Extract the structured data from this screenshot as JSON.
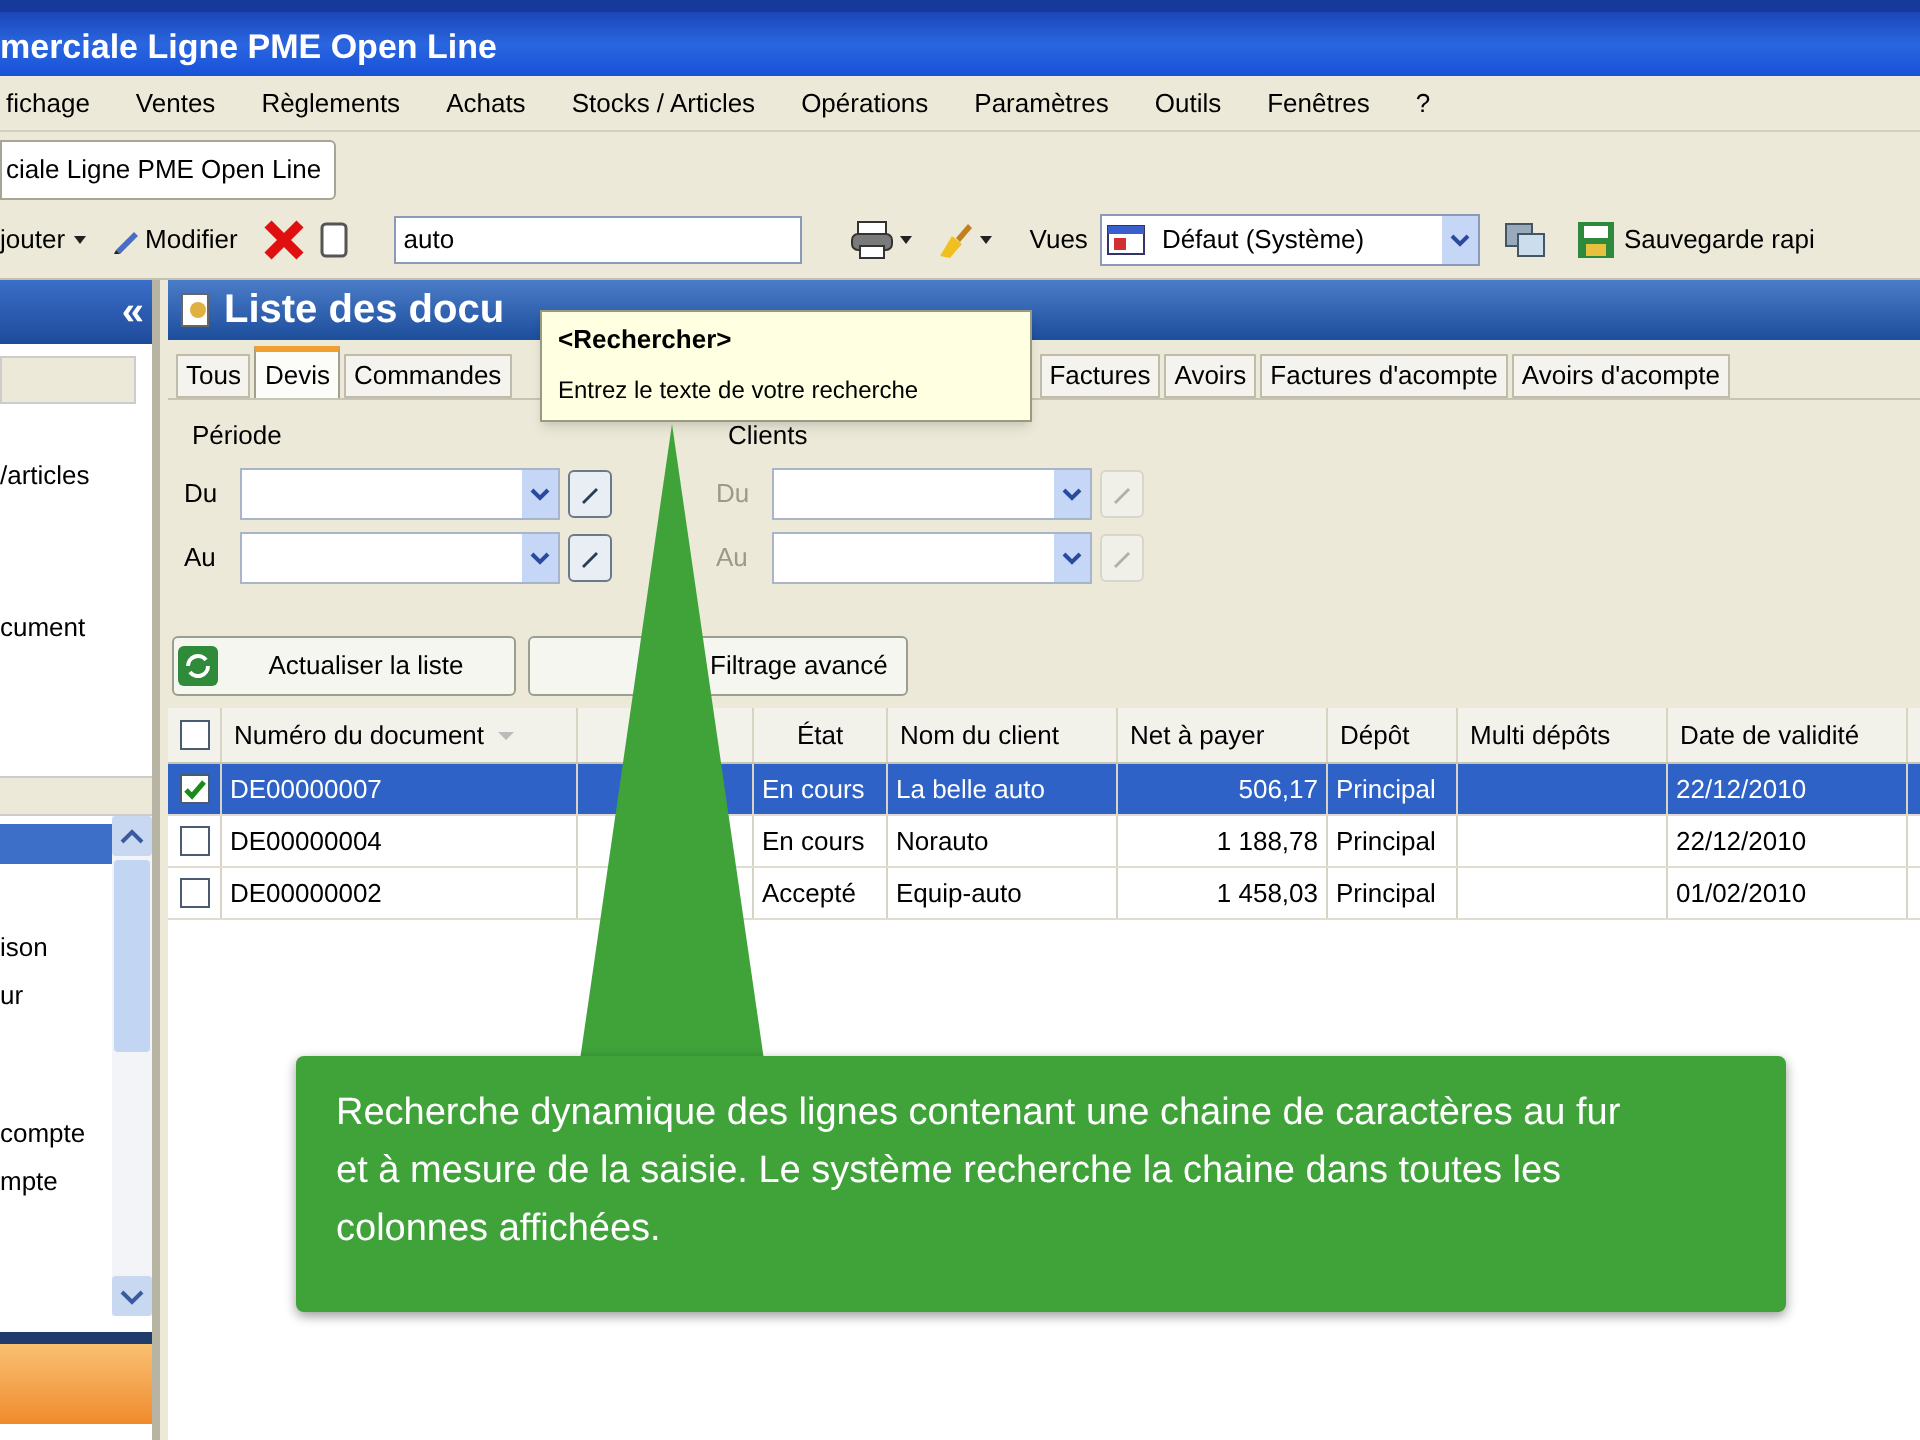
{
  "window": {
    "title": "merciale Ligne PME Open Line"
  },
  "menu": [
    "fichage",
    "Ventes",
    "Règlements",
    "Achats",
    "Stocks / Articles",
    "Opérations",
    "Paramètres",
    "Outils",
    "Fenêtres",
    "?"
  ],
  "document_tab": "ciale Ligne PME Open Line",
  "toolbar": {
    "add_label": "jouter",
    "edit_label": "Modifier",
    "search": {
      "value": "auto"
    },
    "views_label": "Vues",
    "view": "Défaut (Système)",
    "quick_save": "Sauvegarde rapi"
  },
  "sidebar": {
    "collapse": "«",
    "top_items": [
      "/articles",
      "cument"
    ],
    "bottom_items": [
      {
        "selected": true
      },
      {
        "label": "ison",
        "selected": false
      },
      {
        "label": "ur",
        "selected": false
      },
      {
        "label": "compte",
        "selected": false
      },
      {
        "label": "mpte",
        "selected": false
      }
    ]
  },
  "panel": {
    "title": "Liste des docu",
    "tabs": [
      {
        "label": "Tous",
        "selected": false
      },
      {
        "label": "Devis",
        "selected": true
      },
      {
        "label": "Commandes",
        "selected": false
      },
      {
        "label": "Factures",
        "selected": false
      },
      {
        "label": "Avoirs",
        "selected": false
      },
      {
        "label": "Factures d'acompte",
        "selected": false
      },
      {
        "label": "Avoirs d'acompte",
        "selected": false
      }
    ],
    "tooltip": {
      "title": "<Rechercher>",
      "text": "Entrez le texte de votre recherche"
    },
    "period": {
      "legend": "Période",
      "from_label": "Du",
      "to_label": "Au",
      "disabled": false
    },
    "clients": {
      "legend": "Clients",
      "from_label": "Du",
      "to_label": "Au",
      "disabled": true
    },
    "refresh_button": "Actualiser la liste",
    "filter_button": "Filtrage avancé"
  },
  "table": {
    "select_all_checked": false,
    "columns": [
      "Numéro du document",
      "État",
      "Nom du client",
      "Net à payer",
      "Dépôt",
      "Multi dépôts",
      "Date de validité"
    ],
    "rows": [
      {
        "checked": true,
        "selected": true,
        "number": "DE00000007",
        "state": "En cours",
        "client": "La belle auto",
        "net": "506,17",
        "depot": "Principal",
        "validity": "22/12/2010"
      },
      {
        "checked": false,
        "selected": false,
        "number": "DE00000004",
        "state": "En cours",
        "client": "Norauto",
        "net": "1 188,78",
        "depot": "Principal",
        "validity": "22/12/2010"
      },
      {
        "checked": false,
        "selected": false,
        "number": "DE00000002",
        "state": "Accepté",
        "client": "Equip-auto",
        "net": "1 458,03",
        "depot": "Principal",
        "validity": "01/02/2010"
      }
    ]
  },
  "callout": {
    "text": "Recherche dynamique des lignes contenant une chaine de caractères au fur et à mesure de la saisie. Le système recherche la chaine dans toutes les colonnes affichées."
  }
}
